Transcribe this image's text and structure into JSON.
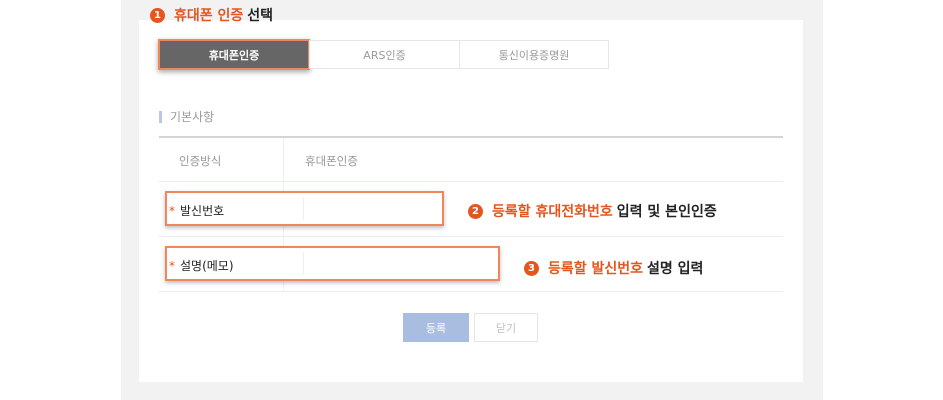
{
  "steps": [
    {
      "num": "1",
      "highlight": "휴대폰 인증",
      "rest": "선택"
    },
    {
      "num": "2",
      "highlight": "등록할 휴대전화번호",
      "rest": "입력 및 본인인증"
    },
    {
      "num": "3",
      "highlight": "등록할 발신번호",
      "rest": "설명 입력"
    }
  ],
  "tabs": [
    "휴대폰인증",
    "ARS인증",
    "통신이용증명원"
  ],
  "section_title": "기본사항",
  "form": {
    "method_label": "인증방식",
    "method_value": "휴대폰인증",
    "required_mark": "*",
    "sender_label": "발신번호",
    "sender_value": "",
    "memo_label": "설명(메모)",
    "memo_value": ""
  },
  "buttons": {
    "register": "등록",
    "close": "닫기"
  },
  "colors": {
    "accent": "#e4561e",
    "highlight_border": "#f0875a",
    "primary_button": "#a9bde0",
    "active_tab": "#666666"
  }
}
